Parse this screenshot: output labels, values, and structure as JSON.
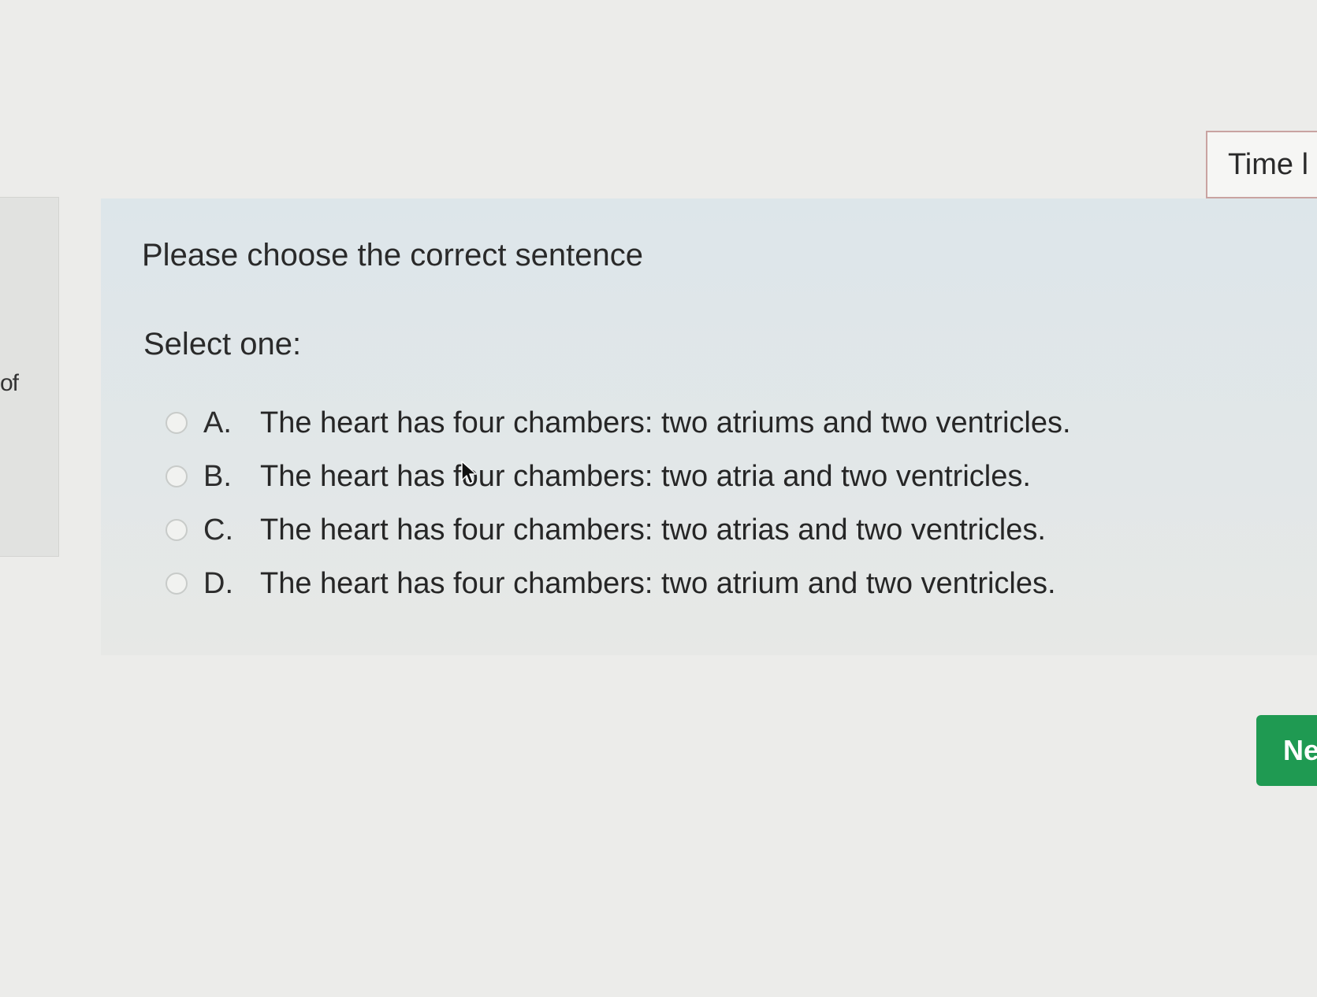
{
  "timer": {
    "label": "Time l"
  },
  "left_panel": {
    "fragment_text": "of"
  },
  "question": {
    "text": "Please choose the  correct sentence",
    "prompt": "Select one:"
  },
  "answers": [
    {
      "letter": "A.",
      "text": "The heart has four chambers: two atriums and two ventricles."
    },
    {
      "letter": "B.",
      "text": "The heart has four chambers: two atria and two ventricles."
    },
    {
      "letter": "C.",
      "text": "The heart has four chambers: two atrias and two ventricles."
    },
    {
      "letter": "D.",
      "text": "The heart has four chambers: two atrium and two ventricles."
    }
  ],
  "next_button": {
    "label": "Ne"
  },
  "colors": {
    "background": "#ececea",
    "next_button": "#1f9a52",
    "timer_border": "#c9a3a1"
  },
  "icons": {
    "cursor": "mouse-pointer-icon",
    "radio": "radio-button-icon"
  }
}
